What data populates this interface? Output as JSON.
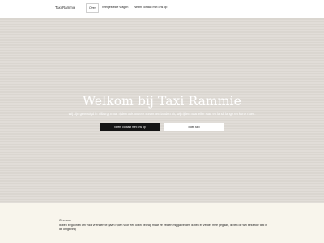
{
  "header": {
    "brand": "Taxi Rammie",
    "nav": [
      {
        "label": "Over"
      },
      {
        "label": "Veelgestelde vragen"
      },
      {
        "label": "Neem contact met ons op"
      }
    ]
  },
  "hero": {
    "title": "Welkom bij Taxi Rammie",
    "subtitle": "Wij zijn gevestigd in Tilburg, maar rijden ook andere steden en landen uit, wij rijden naar elke stad en land, lange en korte ritten.",
    "primary_button": "Neem contact met ons op",
    "secondary_button": "Boek taxi"
  },
  "about": {
    "heading": "Over ons",
    "text": "Ik ben begonnen om voor vrienden te gaan rijden voor een klein bedrag maar ze zeiden mij ga verder, ik ben er verder mee gegaan, ik ben de wel bekende taxi in de omgeving"
  }
}
